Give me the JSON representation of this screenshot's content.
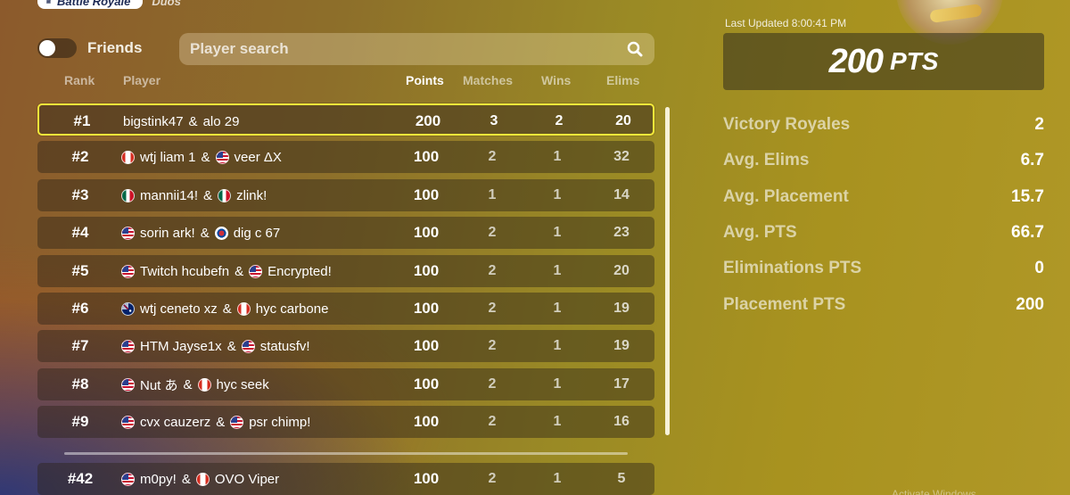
{
  "header": {
    "mode_label": "Battle Royale",
    "mode_sub": "Duos"
  },
  "friends": {
    "label": "Friends",
    "enabled": false
  },
  "search": {
    "placeholder": "Player search",
    "value": ""
  },
  "columns": {
    "rank": "Rank",
    "player": "Player",
    "points": "Points",
    "matches": "Matches",
    "wins": "Wins",
    "elims": "Elims"
  },
  "rows": [
    {
      "rank": "#1",
      "p1_flag": "",
      "p1": "bigstink47",
      "sep": "&",
      "p2_flag": "",
      "p2": "alo 29",
      "points": "200",
      "matches": "3",
      "wins": "2",
      "elims": "20",
      "highlight": true
    },
    {
      "rank": "#2",
      "p1_flag": "ca",
      "p1": "wtj liam 1",
      "sep": "&",
      "p2_flag": "us",
      "p2": "veer ΔX",
      "points": "100",
      "matches": "2",
      "wins": "1",
      "elims": "32"
    },
    {
      "rank": "#3",
      "p1_flag": "mx",
      "p1": "mannii14!",
      "sep": "&",
      "p2_flag": "mx",
      "p2": "zlink!",
      "points": "100",
      "matches": "1",
      "wins": "1",
      "elims": "14"
    },
    {
      "rank": "#4",
      "p1_flag": "us",
      "p1": "sorin ark!",
      "sep": "&",
      "p2_flag": "kr",
      "p2": "dig c 67",
      "points": "100",
      "matches": "2",
      "wins": "1",
      "elims": "23"
    },
    {
      "rank": "#5",
      "p1_flag": "us",
      "p1": "Twitch hcubefn",
      "sep": "&",
      "p2_flag": "us",
      "p2": "Encrypted!",
      "points": "100",
      "matches": "2",
      "wins": "1",
      "elims": "20"
    },
    {
      "rank": "#6",
      "p1_flag": "au",
      "p1": "wtj ceneto xz",
      "sep": "&",
      "p2_flag": "ca",
      "p2": "hyc carbone",
      "points": "100",
      "matches": "2",
      "wins": "1",
      "elims": "19"
    },
    {
      "rank": "#7",
      "p1_flag": "us",
      "p1": "HTM Jayse1x",
      "sep": "&",
      "p2_flag": "us",
      "p2": "statusfv!",
      "points": "100",
      "matches": "2",
      "wins": "1",
      "elims": "19"
    },
    {
      "rank": "#8",
      "p1_flag": "us",
      "p1": "Nut あ",
      "sep": "&",
      "p2_flag": "ca",
      "p2": "hyc seek",
      "points": "100",
      "matches": "2",
      "wins": "1",
      "elims": "17"
    },
    {
      "rank": "#9",
      "p1_flag": "us",
      "p1": "cvx cauzerz",
      "sep": "&",
      "p2_flag": "us",
      "p2": "psr chimp!",
      "points": "100",
      "matches": "2",
      "wins": "1",
      "elims": "16"
    }
  ],
  "my_row": {
    "rank": "#42",
    "p1_flag": "us",
    "p1": "m0py!",
    "sep": "&",
    "p2_flag": "ca",
    "p2": "OVO Viper",
    "points": "100",
    "matches": "2",
    "wins": "1",
    "elims": "5"
  },
  "summary": {
    "last_updated": "Last Updated 8:00:41 PM",
    "points": "200",
    "points_unit": "PTS",
    "stats": [
      {
        "label": "Victory Royales",
        "value": "2"
      },
      {
        "label": "Avg. Elims",
        "value": "6.7"
      },
      {
        "label": "Avg. Placement",
        "value": "15.7"
      },
      {
        "label": "Avg. PTS",
        "value": "66.7"
      },
      {
        "label": "Eliminations PTS",
        "value": "0"
      },
      {
        "label": "Placement PTS",
        "value": "200"
      }
    ]
  },
  "watermark": "Activate Windows",
  "colors": {
    "highlight_border": "#f5e93a",
    "row_bg": "rgba(45,35,25,0.45)"
  }
}
